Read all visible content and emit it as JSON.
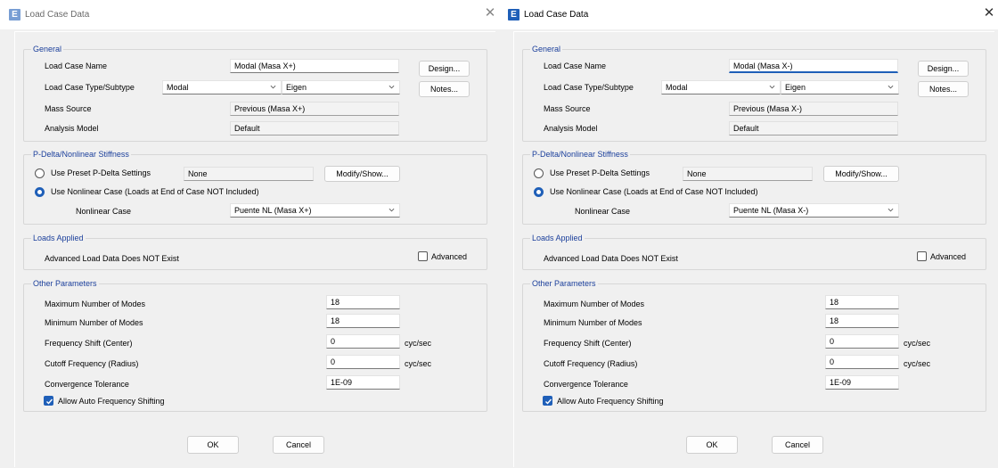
{
  "accent_color": "#1f5fb8",
  "group_title_color": "#1b3f9b",
  "dialogs": [
    {
      "title": "Load Case Data",
      "general": {
        "group_title": "General",
        "name_label": "Load Case Name",
        "name_value": "Modal (Masa X+)",
        "type_label": "Load Case Type/Subtype",
        "type_value": "Modal",
        "subtype_value": "Eigen",
        "mass_label": "Mass Source",
        "mass_value": "Previous (Masa X+)",
        "model_label": "Analysis Model",
        "model_value": "Default",
        "design_button": "Design...",
        "notes_button": "Notes..."
      },
      "pdelta": {
        "group_title": "P-Delta/Nonlinear Stiffness",
        "preset_label": "Use Preset P-Delta Settings",
        "preset_value": "None",
        "modify_button": "Modify/Show...",
        "nonlinear_label": "Use Nonlinear Case  (Loads at End of Case NOT Included)",
        "nl_case_label": "Nonlinear Case",
        "nl_case_value": "Puente NL (Masa X+)"
      },
      "loads": {
        "group_title": "Loads Applied",
        "status_text": "Advanced Load Data Does NOT Exist",
        "advanced_label": "Advanced"
      },
      "other": {
        "group_title": "Other Parameters",
        "max_modes_label": "Maximum Number of Modes",
        "max_modes_value": "18",
        "min_modes_label": "Minimum Number of Modes",
        "min_modes_value": "18",
        "freq_shift_label": "Frequency Shift  (Center)",
        "freq_shift_value": "0",
        "freq_shift_unit": "cyc/sec",
        "cutoff_label": "Cutoff Frequency  (Radius)",
        "cutoff_value": "0",
        "cutoff_unit": "cyc/sec",
        "tolerance_label": "Convergence Tolerance",
        "tolerance_value": "1E-09",
        "auto_shift_label": "Allow Auto Frequency Shifting"
      },
      "ok_button": "OK",
      "cancel_button": "Cancel"
    },
    {
      "title": "Load Case Data",
      "general": {
        "group_title": "General",
        "name_label": "Load Case Name",
        "name_value": "Modal (Masa X-)",
        "type_label": "Load Case Type/Subtype",
        "type_value": "Modal",
        "subtype_value": "Eigen",
        "mass_label": "Mass Source",
        "mass_value": "Previous (Masa X-)",
        "model_label": "Analysis Model",
        "model_value": "Default",
        "design_button": "Design...",
        "notes_button": "Notes..."
      },
      "pdelta": {
        "group_title": "P-Delta/Nonlinear Stiffness",
        "preset_label": "Use Preset P-Delta Settings",
        "preset_value": "None",
        "modify_button": "Modify/Show...",
        "nonlinear_label": "Use Nonlinear Case  (Loads at End of Case NOT Included)",
        "nl_case_label": "Nonlinear Case",
        "nl_case_value": "Puente NL (Masa X-)"
      },
      "loads": {
        "group_title": "Loads Applied",
        "status_text": "Advanced Load Data Does NOT Exist",
        "advanced_label": "Advanced"
      },
      "other": {
        "group_title": "Other Parameters",
        "max_modes_label": "Maximum Number of Modes",
        "max_modes_value": "18",
        "min_modes_label": "Minimum Number of Modes",
        "min_modes_value": "18",
        "freq_shift_label": "Frequency Shift  (Center)",
        "freq_shift_value": "0",
        "freq_shift_unit": "cyc/sec",
        "cutoff_label": "Cutoff Frequency  (Radius)",
        "cutoff_value": "0",
        "cutoff_unit": "cyc/sec",
        "tolerance_label": "Convergence Tolerance",
        "tolerance_value": "1E-09",
        "auto_shift_label": "Allow Auto Frequency Shifting"
      },
      "ok_button": "OK",
      "cancel_button": "Cancel"
    }
  ]
}
